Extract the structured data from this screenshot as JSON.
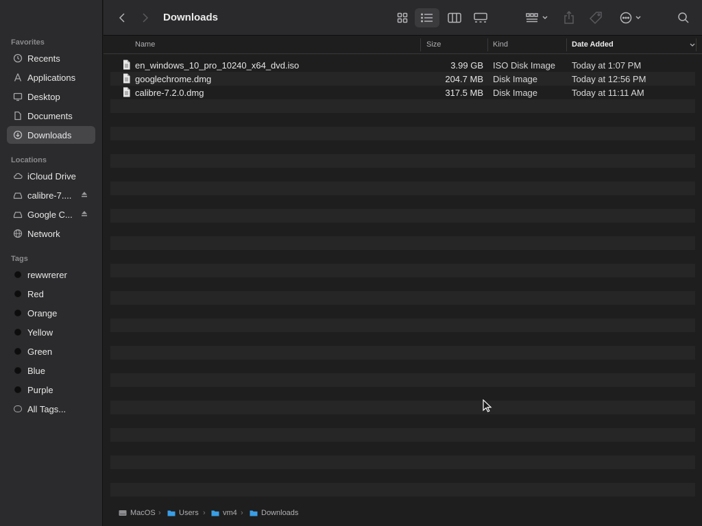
{
  "window": {
    "title": "Downloads"
  },
  "sidebar": {
    "favorites_title": "Favorites",
    "favorites": [
      {
        "label": "Recents",
        "icon": "clock-icon"
      },
      {
        "label": "Applications",
        "icon": "applications-icon"
      },
      {
        "label": "Desktop",
        "icon": "desktop-icon"
      },
      {
        "label": "Documents",
        "icon": "document-icon"
      },
      {
        "label": "Downloads",
        "icon": "download-icon",
        "selected": true
      }
    ],
    "locations_title": "Locations",
    "locations": [
      {
        "label": "iCloud Drive",
        "icon": "cloud-icon"
      },
      {
        "label": "calibre-7....",
        "icon": "disk-icon",
        "ejectable": true
      },
      {
        "label": "Google C...",
        "icon": "disk-icon",
        "ejectable": true
      },
      {
        "label": "Network",
        "icon": "globe-icon"
      }
    ],
    "tags_title": "Tags",
    "tags": [
      {
        "label": "rewwrerer"
      },
      {
        "label": "Red"
      },
      {
        "label": "Orange"
      },
      {
        "label": "Yellow"
      },
      {
        "label": "Green"
      },
      {
        "label": "Blue"
      },
      {
        "label": "Purple"
      },
      {
        "label": "All Tags..."
      }
    ]
  },
  "columns": {
    "name": "Name",
    "size": "Size",
    "kind": "Kind",
    "date_added": "Date Added"
  },
  "files": [
    {
      "name": "en_windows_10_pro_10240_x64_dvd.iso",
      "size": "3.99 GB",
      "kind": "ISO Disk Image",
      "date_added": "Today at 1:07 PM"
    },
    {
      "name": "googlechrome.dmg",
      "size": "204.7 MB",
      "kind": "Disk Image",
      "date_added": "Today at 12:56 PM"
    },
    {
      "name": "calibre-7.2.0.dmg",
      "size": "317.5 MB",
      "kind": "Disk Image",
      "date_added": "Today at 11:11 AM"
    }
  ],
  "pathbar": {
    "crumbs": [
      "MacOS",
      "Users",
      "vm4",
      "Downloads"
    ]
  },
  "colors": {
    "sidebar_bg": "#2b2b2d",
    "content_bg": "#1e1e1e",
    "stripe_bg": "#262627",
    "selected_bg": "#464649",
    "folder_blue": "#3a9ee6"
  }
}
